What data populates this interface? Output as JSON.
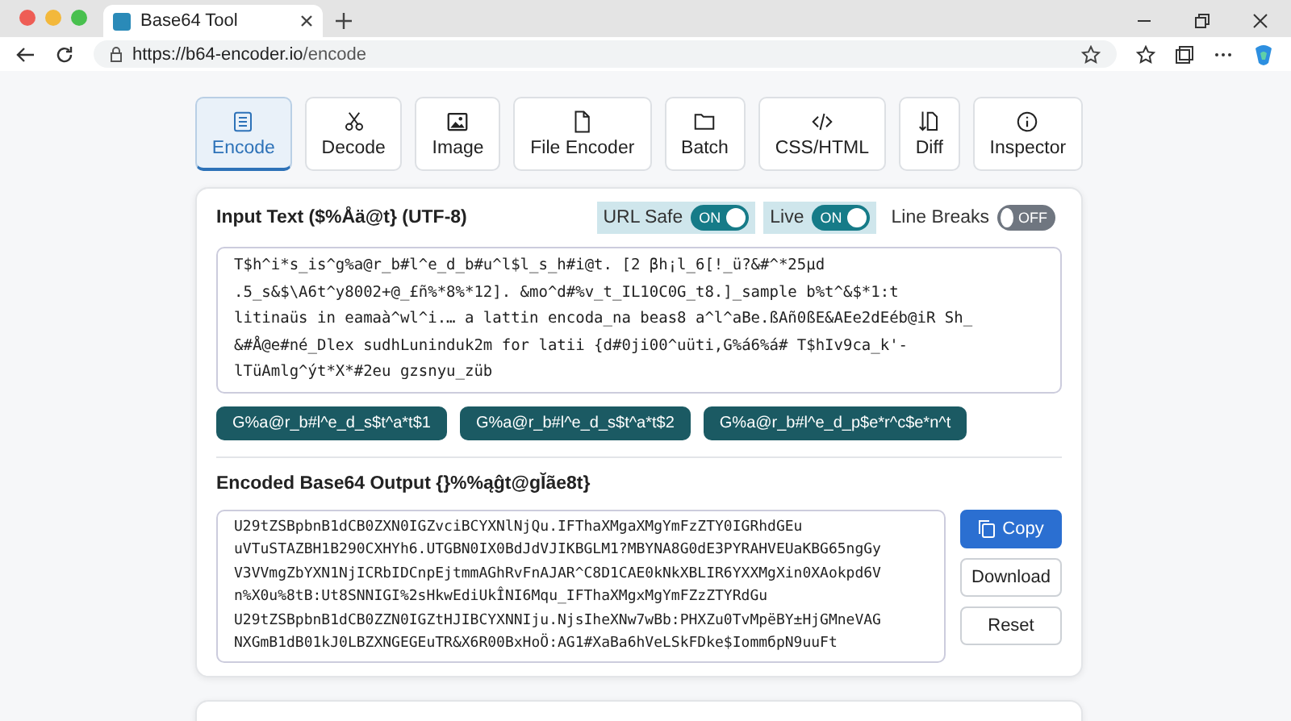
{
  "browser": {
    "tab_title": "Base64 Tool",
    "url_host": "https://b64-encoder.io",
    "url_path": "/encode"
  },
  "tabs": [
    {
      "label": "Encode",
      "selected": true
    },
    {
      "label": "Decode",
      "selected": false
    },
    {
      "label": "Image",
      "selected": false
    },
    {
      "label": "File Encoder",
      "selected": false
    },
    {
      "label": "Batch",
      "selected": false
    },
    {
      "label": "CSS/HTML",
      "selected": false
    },
    {
      "label": "Diff",
      "selected": false
    },
    {
      "label": "Inspector",
      "selected": false
    }
  ],
  "input": {
    "title": "Input Text ($%Åä@t} (UTF-8)",
    "toggles": [
      {
        "label": "URL Safe",
        "state": "ON",
        "on": true
      },
      {
        "label": "Live",
        "state": "ON",
        "on": true
      },
      {
        "label": "Line Breaks",
        "state": "OFF",
        "on": false
      }
    ],
    "value": "T$h^i*s_is^g%a@r_b#l^e_d_b#u^l$l_s_h#i@t. [2 βh¡l_6[!_ü?&#^*25μd\n.5_s&$\\A6t^y8002+@_£ñ%*8%*12]. &mo^d#%v_t_IL10C0G_t8.]_sample b%t^&$*1:t\nlitinaüs in eamaà^wl^i.… a lattin encoda_na beas8 a^l^aBe.ßAñ0ßE&AEe2dEéb@iR Sh_\n&#Å@e#né_Dlex sudhLuninduk2m for latii {d#0ji00^uüti,G%á6%á# T$hIv9ca_k'-\nlTüAmlg^ýt*X*#2eu gzsnyu_züb",
    "chips": [
      "G%a@r_b#l^e_d_s$t^a*t$1",
      "G%a@r_b#l^e_d_s$t^a*t$2",
      "G%a@r_b#l^e_d_p$e*r^c$e*n^t"
    ]
  },
  "output": {
    "title": "Encoded Base64 Output {}%%ąĝt@gĬãe8t}",
    "value": "U29tZSBpbnB1dCB0ZXN0IGZvciBCYXNlNjQu.IFThaXMgaXMgYmFzZTY0IGRhdGEu\nuVTuSTAZBH1B290CXHYh6.UTGBN0IX0BdJdVJIKBGLM1?MBYNA8G0dE3PYRAHVEUaKBG65ngGy\nV3VVmgZbYXN1NjICRbIDCnpEjtmmAGhRvFnAJAR^C8D1CAE0kNkXBLIR6YXXMgXin0XAokpd6V\nn%X0u%8tB:Ut8SNNIGI%2sHkwEdiUkÎNI6Mqu_IFThaXMgxMgYmFZzZTYRdGu\nU29tZSBpbnB1dCB0ZZN0IGZtHJIBCYXNNIju.NjsIheXNw7wBb:PHXZu0TvMpëBY±HjGMneVAG\nNXGmB1dB01kJ0LBZXNGEGEuTR&X6R00BxHoÖ:AG1#XaBa6hVeLSkFDke$IommбpN9uuFt",
    "buttons": [
      {
        "label": "Copy",
        "kind": "primary"
      },
      {
        "label": "Download",
        "kind": "plain"
      },
      {
        "label": "Reset",
        "kind": "plain"
      }
    ]
  }
}
